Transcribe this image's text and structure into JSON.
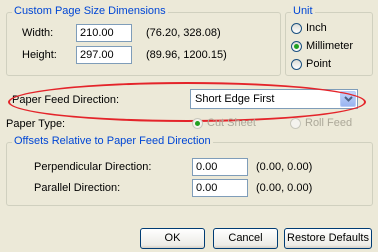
{
  "size_group": {
    "legend": "Custom Page Size Dimensions",
    "width_label": "Width:",
    "width_value": "210.00",
    "width_range": "(76.20, 328.08)",
    "height_label": "Height:",
    "height_value": "297.00",
    "height_range": "(89.96, 1200.15)"
  },
  "unit_group": {
    "legend": "Unit",
    "options": [
      "Inch",
      "Millimeter",
      "Point"
    ],
    "selected": "Millimeter"
  },
  "feed": {
    "label": "Paper Feed Direction:",
    "value": "Short Edge First"
  },
  "paper_type": {
    "label": "Paper Type:",
    "options": [
      "Cut Sheet",
      "Roll Feed"
    ],
    "selected": "Cut Sheet"
  },
  "offsets": {
    "legend": "Offsets Relative to Paper Feed Direction",
    "perp_label": "Perpendicular Direction:",
    "perp_value": "0.00",
    "perp_range": "(0.00, 0.00)",
    "par_label": "Parallel Direction:",
    "par_value": "0.00",
    "par_range": "(0.00, 0.00)"
  },
  "buttons": {
    "ok": "OK",
    "cancel": "Cancel",
    "restore": "Restore Defaults"
  },
  "annotation_color": "#e4242a"
}
